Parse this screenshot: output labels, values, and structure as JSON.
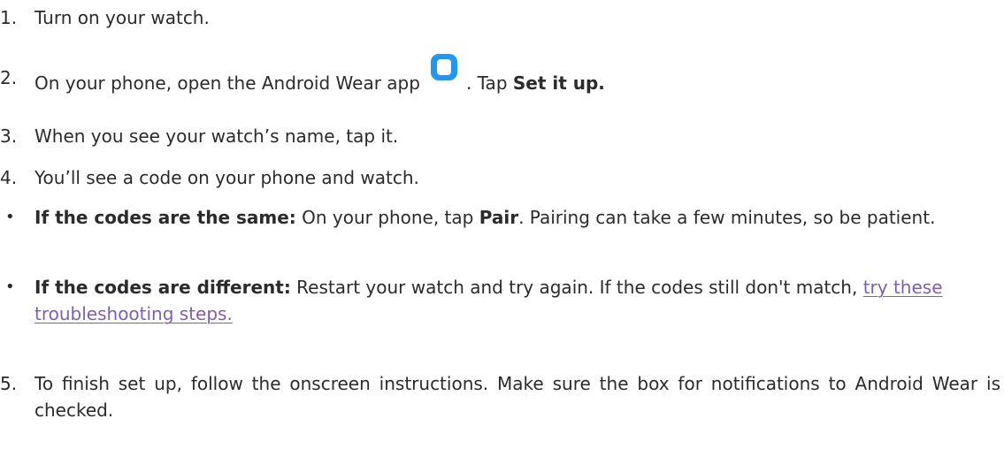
{
  "steps": [
    {
      "marker": "1.",
      "text": "Turn on your watch."
    },
    {
      "marker": "2.",
      "text_before_icon": "On your phone, open the Android Wear app",
      "text_after_icon": ". Tap ",
      "bold": "Set it up."
    },
    {
      "marker": "3.",
      "text": "When you see your watch’s name, tap it."
    },
    {
      "marker": "4.",
      "text": "You’ll see a code on your phone and watch."
    },
    {
      "marker": "•",
      "bold": "If the codes are the same:",
      "text_before": " On your phone, tap ",
      "bold2": "Pair",
      "text_after": ". Pairing can take a few minutes, so be patient."
    },
    {
      "marker": "•",
      "bold": "If the codes are different:",
      "text_before": " Restart your watch and try again. If the codes still don't match, ",
      "link": "try these troubleshooting steps."
    },
    {
      "marker": "5.",
      "text": "To finish set up, follow the onscreen instructions. Make sure the box for notifications to Android Wear is checked."
    }
  ],
  "icons": {
    "app_icon": "android-wear-app-icon",
    "app_icon_color": "#2196f3"
  },
  "colors": {
    "text": "#2b2b2b",
    "link": "#7f5fb0"
  }
}
